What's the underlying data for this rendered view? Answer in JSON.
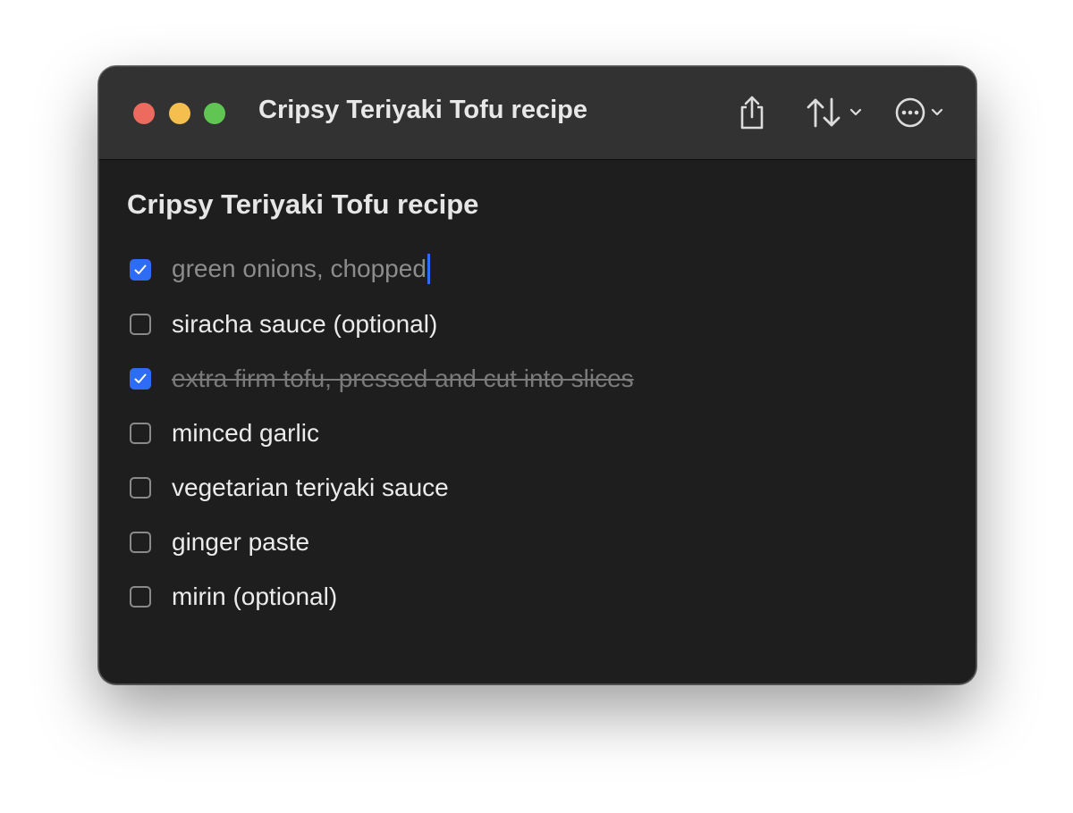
{
  "window": {
    "title": "Cripsy Teriyaki Tofu recipe"
  },
  "toolbar": {
    "share_icon": "share-icon",
    "sort_icon": "sort-arrows-icon",
    "more_icon": "ellipsis-circle-icon"
  },
  "note": {
    "title": "Cripsy Teriyaki Tofu recipe",
    "items": [
      {
        "label": "green onions, chopped",
        "checked": true,
        "strikethrough": false
      },
      {
        "label": "siracha sauce (optional)",
        "checked": false,
        "strikethrough": false
      },
      {
        "label": "extra firm tofu, pressed and cut into slices",
        "checked": true,
        "strikethrough": true
      },
      {
        "label": "minced garlic",
        "checked": false,
        "strikethrough": false
      },
      {
        "label": "vegetarian teriyaki sauce",
        "checked": false,
        "strikethrough": false
      },
      {
        "label": "ginger paste",
        "checked": false,
        "strikethrough": false
      },
      {
        "label": "mirin (optional)",
        "checked": false,
        "strikethrough": false
      }
    ]
  },
  "colors": {
    "accent": "#2f6cf5",
    "close": "#ec6a5e",
    "minimize": "#f4bf4f",
    "maximize": "#61c554"
  }
}
